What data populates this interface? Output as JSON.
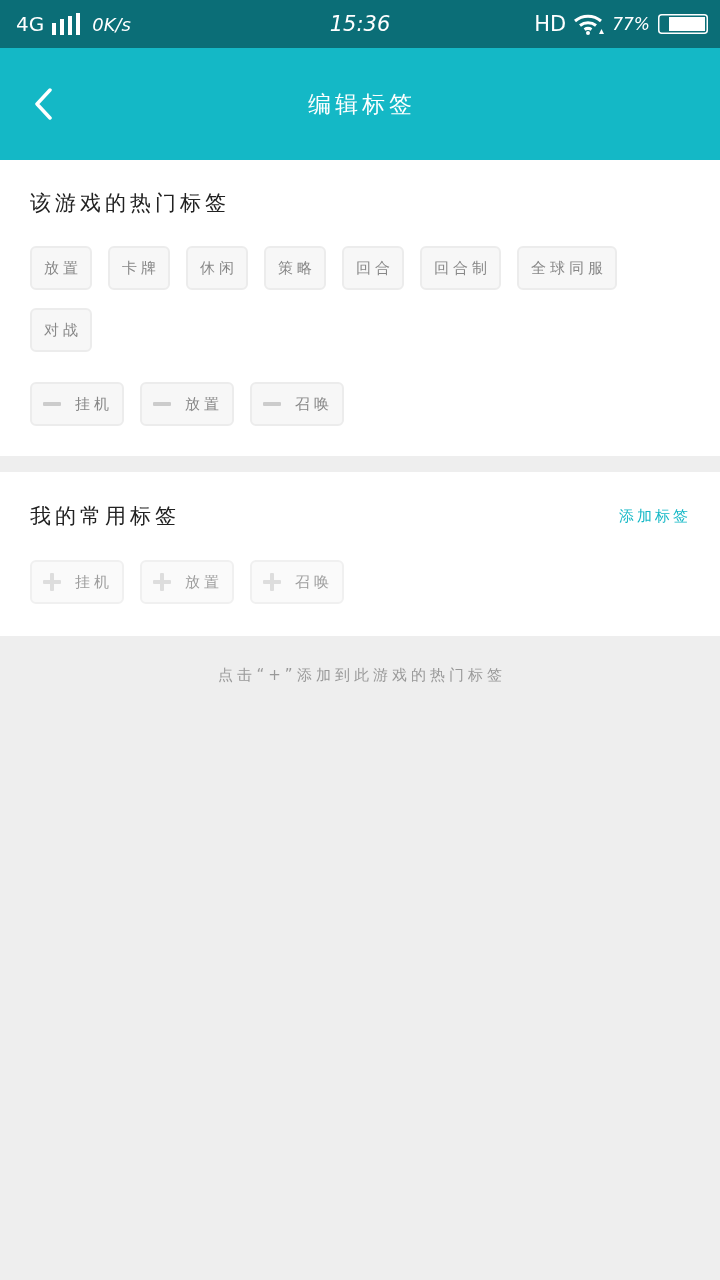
{
  "status_bar": {
    "network": "4G",
    "speed": "0K/s",
    "time": "15:36",
    "hd": "HD",
    "battery": "77%"
  },
  "header": {
    "title": "编辑标签"
  },
  "hot_section": {
    "title": "该游戏的热门标签",
    "tags": [
      {
        "label": "放置"
      },
      {
        "label": "卡牌"
      },
      {
        "label": "休闲"
      },
      {
        "label": "策略"
      },
      {
        "label": "回合"
      },
      {
        "label": "回合制"
      },
      {
        "label": "全球同服"
      },
      {
        "label": "对战"
      }
    ],
    "added_tags": [
      {
        "label": "挂机",
        "kind": "remove",
        "disabled": false
      },
      {
        "label": "放置",
        "kind": "remove",
        "disabled": false
      },
      {
        "label": "召唤",
        "kind": "remove",
        "disabled": false
      }
    ]
  },
  "my_section": {
    "title": "我的常用标签",
    "action": "添加标签",
    "tags": [
      {
        "label": "挂机",
        "kind": "add",
        "disabled": true
      },
      {
        "label": "放置",
        "kind": "add",
        "disabled": true
      },
      {
        "label": "召唤",
        "kind": "add",
        "disabled": true
      }
    ]
  },
  "hint": "点击“+”添加到此游戏的热门标签"
}
